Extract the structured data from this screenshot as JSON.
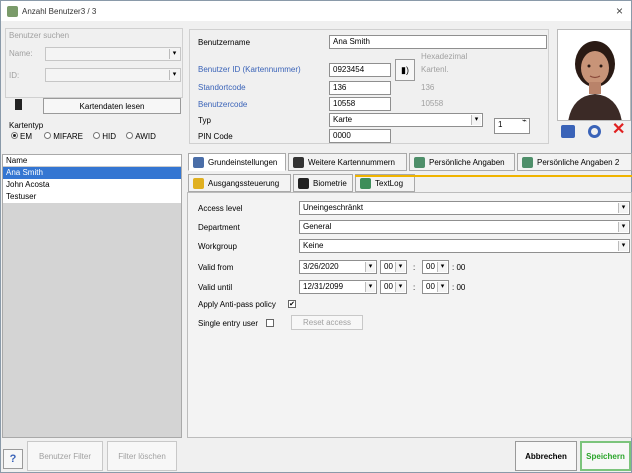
{
  "window": {
    "title": "Anzahl Benutzer3 / 3",
    "close": "×"
  },
  "search": {
    "label": "Benutzer suchen",
    "name_label": "Name:",
    "id_label": "ID:",
    "read_card_button": "Kartendaten lesen",
    "card_type_label": "Kartentyp",
    "card_types": [
      "EM",
      "MIFARE",
      "HID",
      "AWID"
    ],
    "card_type_selected": "EM"
  },
  "user_list": {
    "header": "Name",
    "rows": [
      "Ana Smith",
      "John Acosta",
      "Testuser"
    ],
    "selected": "Ana Smith"
  },
  "details": {
    "username_label": "Benutzername",
    "username_value": "Ana Smith",
    "user_id_label": "Benutzer ID (Kartennummer)",
    "user_id_value": "0923454",
    "site_code_label": "Standortcode",
    "site_code_value": "136",
    "user_code_label": "Benutzercode",
    "user_code_value": "10558",
    "type_label": "Typ",
    "type_value": "Karte",
    "pin_label": "PIN Code",
    "pin_value": "0000",
    "ghost_labels": [
      "Hexadezimal",
      "Kartenl.",
      "136",
      "10558"
    ],
    "pin_count_value": "1"
  },
  "tabs_row1": [
    {
      "label": "Grundeinstellungen"
    },
    {
      "label": "Weitere Kartennummern"
    },
    {
      "label": "Persönliche Angaben"
    },
    {
      "label": "Persönliche Angaben 2"
    }
  ],
  "tabs_row2": [
    {
      "label": "Ausgangssteuerung"
    },
    {
      "label": "Biometrie"
    },
    {
      "label": "TextLog"
    }
  ],
  "settings": {
    "access_level_label": "Access level",
    "access_level_value": "Uneingeschränkt",
    "department_label": "Department",
    "department_value": "General",
    "workgroup_label": "Workgroup",
    "workgroup_value": "Keine",
    "valid_from_label": "Valid from",
    "valid_from_date": "3/26/2020",
    "valid_from_hour": "00",
    "valid_from_min": "00",
    "valid_from_sec": "00",
    "valid_until_label": "Valid until",
    "valid_until_date": "12/31/2099",
    "valid_until_hour": "00",
    "valid_until_min": "00",
    "valid_until_sec": "00",
    "anti_pass_label": "Apply Anti-pass policy",
    "anti_pass_checked": "✔",
    "single_entry_label": "Single entry user",
    "reset_access_button": "Reset access",
    "colon": ":"
  },
  "footer": {
    "help": "?",
    "user_filter": "Benutzer Filter",
    "filter_reset": "Filter löschen",
    "cancel": "Abbrechen",
    "save": "Speichern"
  },
  "colors": {
    "accent": "#3476d2",
    "save_green": "#2aa52a",
    "delete_red": "#e02020",
    "highlight_line": "#f0b400"
  }
}
